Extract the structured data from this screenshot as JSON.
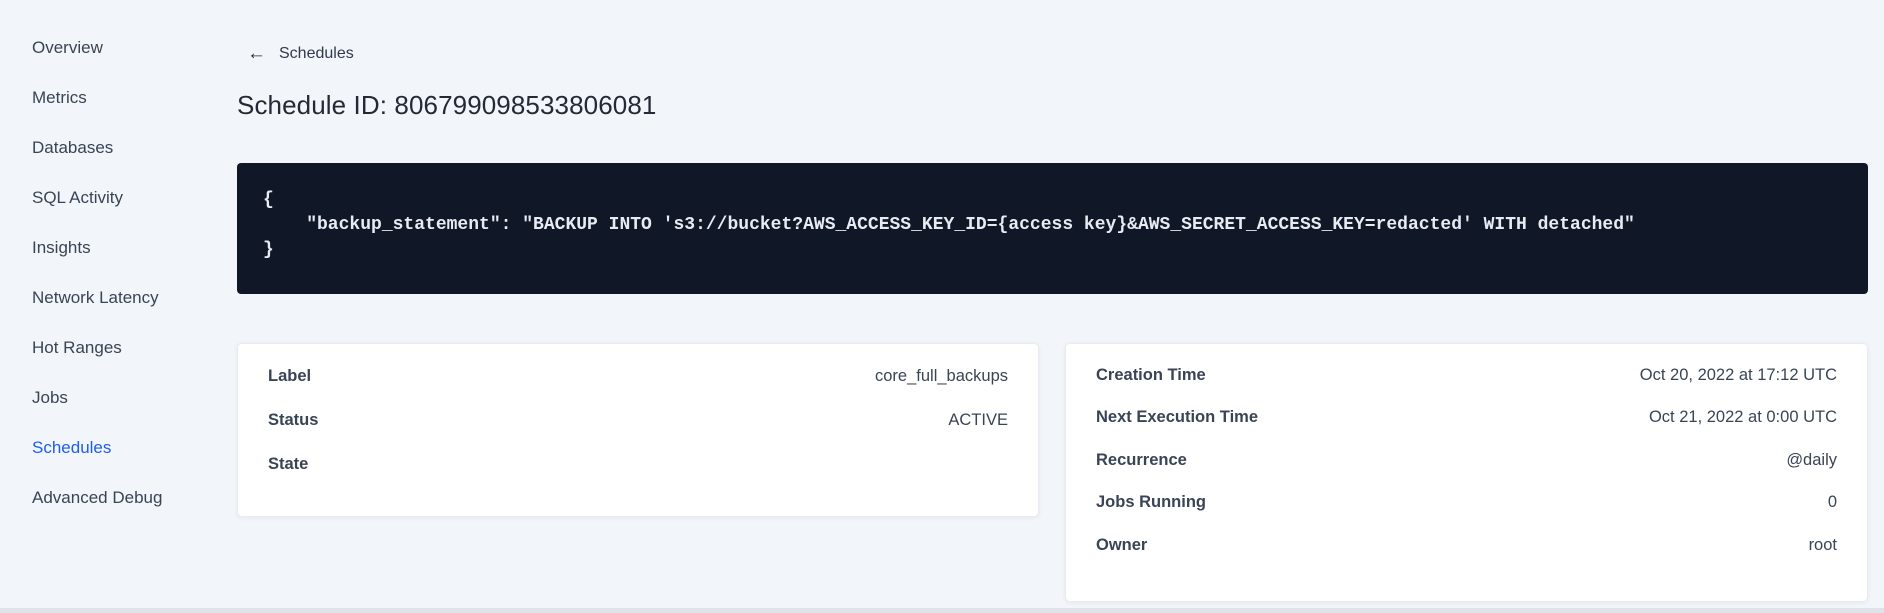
{
  "sidebar": {
    "items": [
      {
        "label": "Overview"
      },
      {
        "label": "Metrics"
      },
      {
        "label": "Databases"
      },
      {
        "label": "SQL Activity"
      },
      {
        "label": "Insights"
      },
      {
        "label": "Network Latency"
      },
      {
        "label": "Hot Ranges"
      },
      {
        "label": "Jobs"
      },
      {
        "label": "Schedules"
      },
      {
        "label": "Advanced Debug"
      }
    ],
    "active_item": "Schedules"
  },
  "header": {
    "back_icon": "←",
    "back_label": "Schedules",
    "title": "Schedule ID: 806799098533806081"
  },
  "code_block": {
    "lines": [
      "{",
      "    \"backup_statement\": \"BACKUP INTO 's3://bucket?AWS_ACCESS_KEY_ID={access key}&AWS_SECRET_ACCESS_KEY=redacted' WITH detached\"",
      "}"
    ]
  },
  "details_card": {
    "rows": [
      {
        "label": "Label",
        "value": "core_full_backups"
      },
      {
        "label": "Status",
        "value": "ACTIVE"
      },
      {
        "label": "State",
        "value": ""
      }
    ]
  },
  "schedule_card": {
    "rows": [
      {
        "label": "Creation Time",
        "value": "Oct 20, 2022 at 17:12 UTC"
      },
      {
        "label": "Next Execution Time",
        "value": "Oct 21, 2022 at 0:00 UTC"
      },
      {
        "label": "Recurrence",
        "value": "@daily"
      },
      {
        "label": "Jobs Running",
        "value": "0"
      },
      {
        "label": "Owner",
        "value": "root"
      }
    ]
  },
  "colors": {
    "accent_blue": "#1c5ef0",
    "page_bg": "#f2f5f9",
    "code_bg": "#101727",
    "code_text": "#e7ecf2",
    "text_dark": "#242a35",
    "text_slate": "#394455"
  }
}
